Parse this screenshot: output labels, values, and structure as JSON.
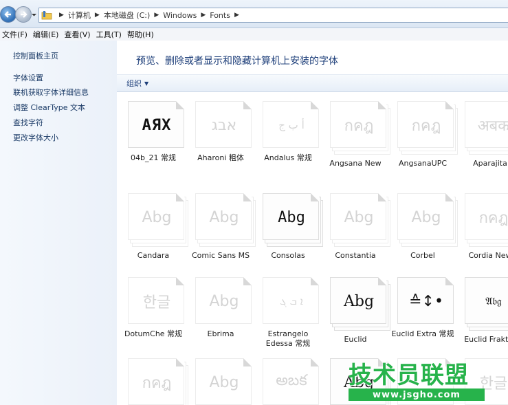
{
  "address": {
    "breadcrumbs": [
      "计算机",
      "本地磁盘 (C:)",
      "Windows",
      "Fonts"
    ]
  },
  "menu": [
    "文件(F)",
    "编辑(E)",
    "查看(V)",
    "工具(T)",
    "帮助(H)"
  ],
  "sidebar": {
    "links": [
      "控制面板主页",
      "字体设置",
      "联机获取字体详细信息",
      "调整 ClearType 文本",
      "查找字符",
      "更改字体大小"
    ]
  },
  "main": {
    "title": "预览、删除或者显示和隐藏计算机上安装的字体",
    "organize_label": "组织"
  },
  "fonts": [
    {
      "name": "04b_21 常规",
      "sample": "AЯX",
      "active": true,
      "stack": false
    },
    {
      "name": "Aharoni 粗体",
      "sample": "אבג",
      "active": false,
      "stack": false
    },
    {
      "name": "Andalus 常规",
      "sample": "أ ب ج",
      "active": false,
      "stack": false
    },
    {
      "name": "Angsana New",
      "sample": "กคฎ",
      "active": false,
      "stack": true
    },
    {
      "name": "AngsanaUPC",
      "sample": "กคฎ",
      "active": false,
      "stack": true
    },
    {
      "name": "Aparajita",
      "sample": "अबक",
      "active": false,
      "stack": true
    },
    {
      "name": "Candara",
      "sample": "Abg",
      "active": false,
      "stack": true
    },
    {
      "name": "Comic Sans MS",
      "sample": "Abg",
      "active": false,
      "stack": true
    },
    {
      "name": "Consolas",
      "sample": "Abg",
      "active": true,
      "stack": true
    },
    {
      "name": "Constantia",
      "sample": "Abg",
      "active": false,
      "stack": true
    },
    {
      "name": "Corbel",
      "sample": "Abg",
      "active": false,
      "stack": true
    },
    {
      "name": "Cordia New",
      "sample": "กคฎ",
      "active": false,
      "stack": true
    },
    {
      "name": "DotumChe 常规",
      "sample": "한글",
      "active": false,
      "stack": false
    },
    {
      "name": "Ebrima",
      "sample": "Abg",
      "active": false,
      "stack": false
    },
    {
      "name": "Estrangelo Edessa 常规",
      "sample": "ܐ ܒ ܓ",
      "active": false,
      "stack": false
    },
    {
      "name": "Euclid",
      "sample": "Abg",
      "active": true,
      "stack": true
    },
    {
      "name": "Euclid Extra 常规",
      "sample": "≙↕•",
      "active": true,
      "stack": false
    },
    {
      "name": "Euclid Fraktur",
      "sample": "𝔄𝔟𝔤",
      "active": true,
      "stack": true
    },
    {
      "name": "",
      "sample": "กคฎ",
      "active": false,
      "stack": true
    },
    {
      "name": "",
      "sample": "Abg",
      "active": false,
      "stack": false
    },
    {
      "name": "",
      "sample": "అబక",
      "active": false,
      "stack": false
    },
    {
      "name": "",
      "sample": "Abg",
      "active": true,
      "stack": true
    },
    {
      "name": "",
      "sample": "",
      "active": false,
      "stack": false
    },
    {
      "name": "",
      "sample": "한글",
      "active": false,
      "stack": false
    }
  ],
  "watermark": {
    "title": "技术员联盟",
    "url": "www.jsgho.com"
  },
  "colors": {
    "link": "#1a3a66",
    "title": "#1e3f7a",
    "watermark": "#27b34b"
  }
}
